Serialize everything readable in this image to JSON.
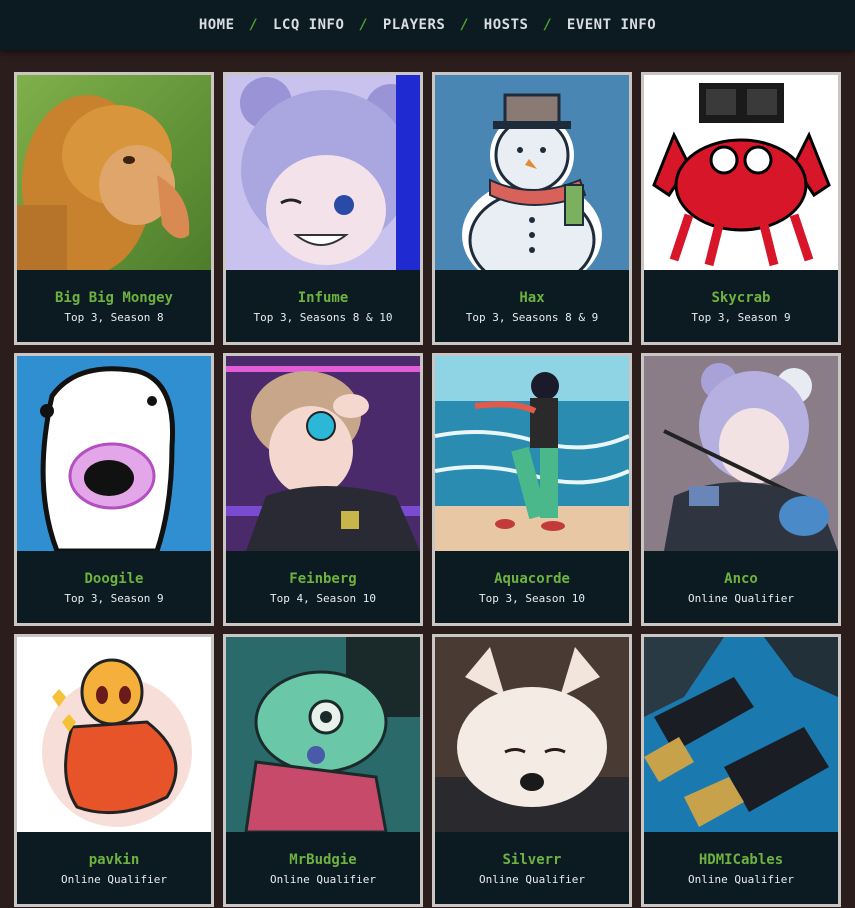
{
  "nav": {
    "items": [
      "HOME",
      "LCQ INFO",
      "PLAYERS",
      "HOSTS",
      "EVENT INFO"
    ],
    "separator": "/"
  },
  "colors": {
    "accent": "#6db33f",
    "panel": "#0c1a22",
    "page": "#2a1d1b",
    "border": "#c9c6c3"
  },
  "players": [
    {
      "name": "Big Big Mongey",
      "subtitle": "Top 3, Season 8",
      "avatar": "proboscis-monkey-photo"
    },
    {
      "name": "Infume",
      "subtitle": "Top 3, Seasons 8 & 10",
      "avatar": "anime-bear-girl-art"
    },
    {
      "name": "Hax",
      "subtitle": "Top 3, Seasons 8 & 9",
      "avatar": "snowman-icon"
    },
    {
      "name": "Skycrab",
      "subtitle": "Top 3, Season 9",
      "avatar": "pixel-crab-sunglasses"
    },
    {
      "name": "Doogile",
      "subtitle": "Top 3, Season 9",
      "avatar": "doodle-face-drawing"
    },
    {
      "name": "Feinberg",
      "subtitle": "Top 4, Season 10",
      "avatar": "anime-glitch-art"
    },
    {
      "name": "Aquacorde",
      "subtitle": "Top 3, Season 10",
      "avatar": "beach-walker-art"
    },
    {
      "name": "Anco",
      "subtitle": "Online Qualifier",
      "avatar": "anime-violinist-art"
    },
    {
      "name": "pavkin",
      "subtitle": "Online Qualifier",
      "avatar": "orange-bird-drawing"
    },
    {
      "name": "MrBudgie",
      "subtitle": "Online Qualifier",
      "avatar": "green-bird-drawing"
    },
    {
      "name": "Silverr",
      "subtitle": "Online Qualifier",
      "avatar": "white-dog-photo"
    },
    {
      "name": "HDMICables",
      "subtitle": "Online Qualifier",
      "avatar": "hdmi-cables-photo"
    }
  ]
}
